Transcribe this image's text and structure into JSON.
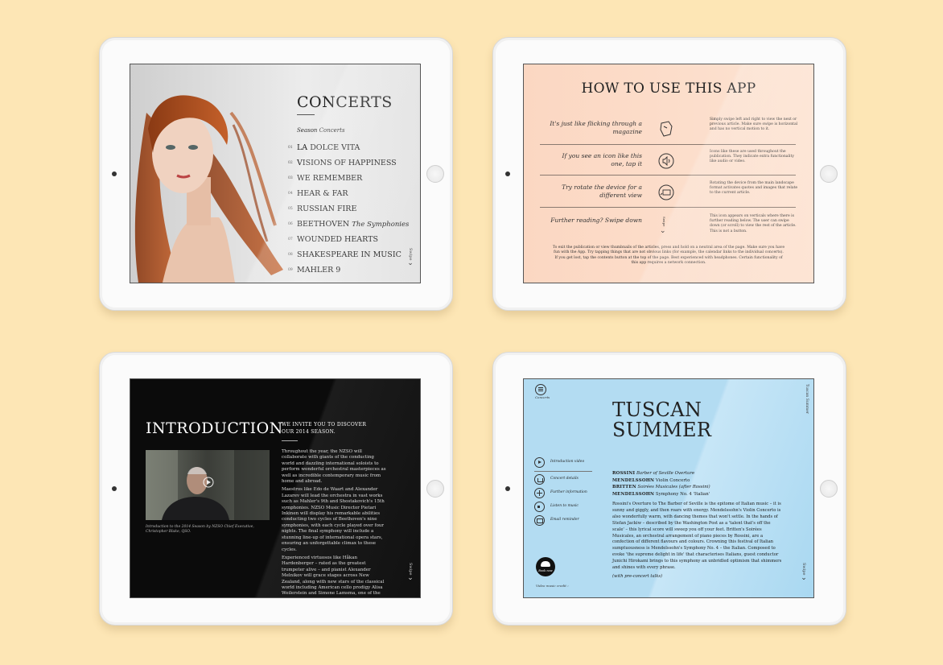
{
  "concerts": {
    "title": "CONCERTS",
    "subtitle": "Season Concerts",
    "items": [
      {
        "num": "01",
        "label": "LA DOLCE VITA",
        "extra": ""
      },
      {
        "num": "02",
        "label": "VISIONS OF HAPPINESS",
        "extra": ""
      },
      {
        "num": "03",
        "label": "WE REMEMBER",
        "extra": ""
      },
      {
        "num": "04",
        "label": "HEAR & FAR",
        "extra": ""
      },
      {
        "num": "05",
        "label": "RUSSIAN FIRE",
        "extra": ""
      },
      {
        "num": "06",
        "label": "BEETHOVEN",
        "extra": "The Symphonies"
      },
      {
        "num": "07",
        "label": "WOUNDED HEARTS",
        "extra": ""
      },
      {
        "num": "08",
        "label": "SHAKESPEARE IN MUSIC",
        "extra": ""
      },
      {
        "num": "09",
        "label": "MAHLER 9",
        "extra": ""
      }
    ],
    "swipe": "Swipe"
  },
  "howto": {
    "title": "HOW TO USE THIS APP",
    "rows": [
      {
        "lead": "It's just like flicking through a magazine",
        "icon": "swipe-hand-icon",
        "desc": "Simply swipe left and right to view the next or previous article. Make sure swipe is horizontal and has no vertical motion to it."
      },
      {
        "lead": "If you see an icon like this one, tap it",
        "icon": "speaker-icon",
        "desc": "Icons like these are used throughout the publication. They indicate extra functionality like audio or video."
      },
      {
        "lead": "Try rotate the device for a different view",
        "icon": "rotate-icon",
        "desc": "Rotating the device from the main landscape format activates quotes and images that relate to the current article."
      },
      {
        "lead": "Further reading? Swipe down",
        "icon": "swipe-down-icon",
        "desc": "This icon appears on verticals where there is further reading below. The user can swipe down (or scroll) to view the rest of the article. This is not a button."
      }
    ],
    "footer": "To exit the publication or view thumbnails of the articles, press and hold on a neutral area of the page. Make sure you have fun with the App. Try tapping things that are not obvious links (for example, the calendar links to the individual concerts). If you get lost, tap the contents button at the top of the page. Best experienced with headphones. Certain functionality of this app requires a network connection.",
    "icon_swipe_label": "Swipe"
  },
  "intro": {
    "title": "INTRODUCTION",
    "heading": "WE INVITE YOU TO DISCOVER OUR 2014 SEASON.",
    "caption": "Introduction to the 2014 Season by NZSO Chief Executive, Christopher Blake, QSO.",
    "paragraphs": [
      "Throughout the year, the NZSO will collaborate with giants of the conducting world and dazzling international soloists to perform wonderful orchestral masterpieces as well as incredible contemporary music from home and abroad.",
      "Maestros like Edo de Waart and Alexander Lazarev will lead the orchestra in vast works such as Mahler's 9th and Shostakovich's 15th symphonies. NZSO Music Director Pietari Inkinen will display his remarkable abilities conducting two cycles of Beethoven's nine symphonies, with each cycle played over four nights. The final symphony will include a stunning line-up of international opera stars, ensuring an unforgettable climax to these cycles.",
      "Experienced virtuosos like Håkan Hardenberger – rated as the greatest trumpeter alive – and pianist Alexander Melnikov will grace stages across New Zealand, along with new stars of the classical world including American cello prodigy Alisa Weilerstein and Simone Lamsma, one of the world's leading violinists. These and other gifted guest artists are sought after in famed concert halls and opera houses around the world, enchanting audiences"
    ],
    "swipe": "Swipe"
  },
  "tuscan": {
    "menu_label": "Concerts",
    "side_label": "Tuscan Summer",
    "title_line1": "TUSCAN",
    "title_line2": "SUMMER",
    "nav": [
      {
        "icon": "play-icon",
        "label": "Introduction video"
      },
      {
        "icon": "home-icon",
        "label": "Concert details"
      },
      {
        "icon": "plus-icon",
        "label": "Further information"
      },
      {
        "icon": "audio-icon",
        "label": "Listen to music"
      },
      {
        "icon": "mail-icon",
        "label": "Email reminder"
      }
    ],
    "book_label": "Book now",
    "credit": "Video music credit",
    "program": [
      {
        "composer": "ROSSINI",
        "work": "Barber of Seville Overture"
      },
      {
        "composer": "MENDELSSOHN",
        "work": "Violin Concerto"
      },
      {
        "composer": "BRITTEN",
        "work": "Soirées Musicales (after Rossini)"
      },
      {
        "composer": "MENDELSSOHN",
        "work": "Symphony No. 4 'Italian'"
      }
    ],
    "body": "Rossini's Overture to The Barber of Seville is the epitome of Italian music – it is sunny and giggly, and then roars with energy. Mendelssohn's Violin Concerto is also wonderfully warm, with dancing themes that won't settle. In the hands of Stefan Jackiw – described by the Washington Post as a 'talent that's off the scale' – this lyrical score will sweep you off your feet. Britten's Soirées Musicales, an orchestral arrangement of piano pieces by Rossini, are a confection of different flavours and colours. Crowning this festival of Italian sumptuousness is Mendelssohn's Symphony No. 4 – the Italian. Composed to evoke 'the supreme delight in life' that characterises Italians, guest conductor Junichi Hirokami brings to this symphony an unbridled optimism that shimmers and shines with every phrase.",
    "note": "(with pre-concert talks)",
    "swipe": "Swipe"
  }
}
